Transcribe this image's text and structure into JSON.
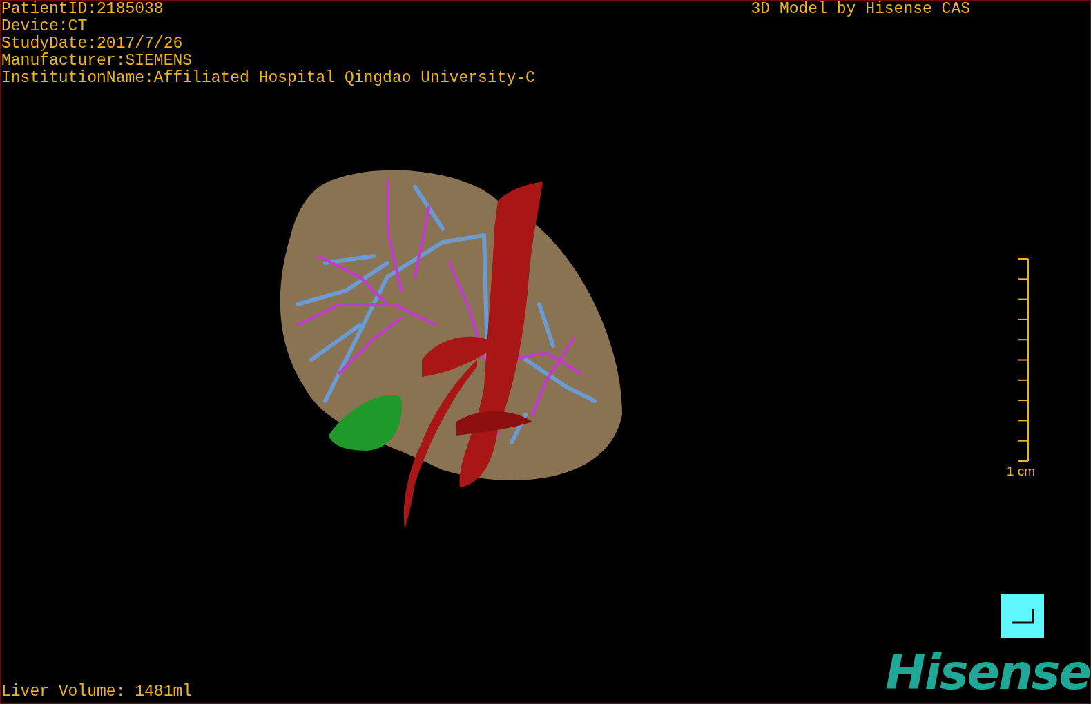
{
  "patient_info": [
    "PatientID:2185038",
    "Device:CT",
    "StudyDate:2017/7/26",
    "Manufacturer:SIEMENS",
    "InstitutionName:Affiliated Hospital Qingdao University-C"
  ],
  "title": "3D Model by Hisense CAS",
  "scale_bar": {
    "label": "1 cm"
  },
  "liver_volume": "Liver Volume: 1481ml",
  "logo": "Hisense"
}
